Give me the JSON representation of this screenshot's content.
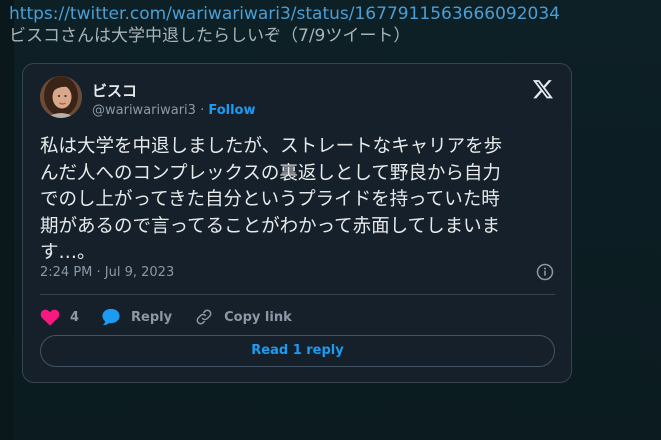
{
  "header": {
    "url": "https://twitter.com/wariwariwari3/status/1677911563666092034",
    "subtitle": "ビスコさんは大学中退したらしいぞ（7/9ツイート）"
  },
  "tweet": {
    "author_name": "ビスコ",
    "handle": "@wariwariwari3",
    "separator": "·",
    "follow_label": "Follow",
    "text": "私は大学を中退しましたが、ストレートなキャリアを歩\nんだ人へのコンプレックスの裏返しとして野良から自力\nでのし上がってきた自分というプライドを持っていた時\n期があるので言ってることがわかって赤面してしまいま\nす…。",
    "timestamp": "2:24 PM · Jul 9, 2023",
    "likes_count": "4",
    "reply_label": "Reply",
    "copy_link_label": "Copy link",
    "read_replies_label": "Read 1 reply"
  },
  "icons": {
    "brand": "x-logo-icon",
    "like": "heart-icon",
    "reply": "speech-bubble-icon",
    "copy": "link-icon",
    "info": "info-icon"
  },
  "colors": {
    "accent": "#1d9bf0",
    "like": "#f91880",
    "card_bg": "#15202b",
    "page_bg": "#0c1d22"
  }
}
